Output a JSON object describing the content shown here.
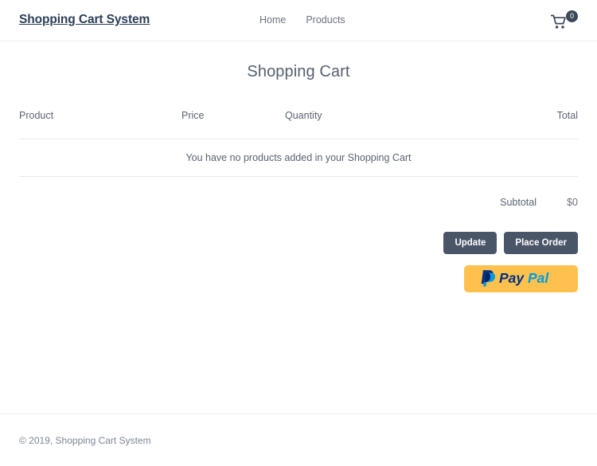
{
  "header": {
    "brand": "Shopping Cart System",
    "nav": [
      {
        "label": "Home"
      },
      {
        "label": "Products"
      }
    ],
    "cart": {
      "icon": "shopping-cart-icon",
      "count": "0"
    }
  },
  "main": {
    "title": "Shopping Cart",
    "table": {
      "columns": [
        "Product",
        "Price",
        "Quantity",
        "Total"
      ],
      "empty_message": "You have no products added in your Shopping Cart",
      "rows": []
    },
    "summary": {
      "subtotal_label": "Subtotal",
      "subtotal_value": "$0"
    },
    "actions": {
      "update_label": "Update",
      "place_order_label": "Place Order",
      "paypal_label": "PayPal",
      "paypal_pay_text": "Pay",
      "paypal_pal_text": "Pal"
    }
  },
  "footer": {
    "copyright": "© 2019, Shopping Cart System"
  },
  "colors": {
    "brand_text": "#2c3e56",
    "button_bg": "#4a5568",
    "paypal_yellow": "#ffc14e",
    "paypal_dark_blue": "#003087",
    "paypal_light_blue": "#009cde",
    "border": "#e8eaed",
    "body_text": "#5a6472"
  }
}
